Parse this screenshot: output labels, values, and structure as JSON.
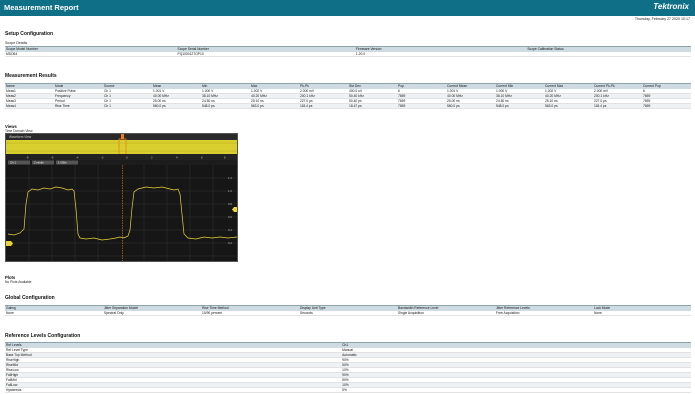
{
  "header": {
    "title": "Measurement Report",
    "logo": "Tektronix",
    "date": "Thursday, February 27 2020 10:17"
  },
  "setup": {
    "title": "Setup Configuration",
    "subtitle": "Scope Details",
    "columns": [
      "Scope Model Number",
      "Scope Serial Number",
      "Firmware Version",
      "Scope Calibration Status"
    ],
    "row": [
      "MSO64",
      "PQ100012TOP10",
      "1.20.0",
      ""
    ]
  },
  "results": {
    "title": "Measurement Results",
    "columns": [
      "Name",
      "Mode",
      "Source",
      "Mean",
      "Min",
      "Max",
      "Pk-Pk",
      "Std Dev",
      "Pop",
      "Current Mean",
      "Current Min",
      "Current Max",
      "Current Pk-Pk",
      "Current Pop"
    ],
    "rows": [
      [
        "Meas1",
        "Positive Pulse",
        "Ch 1",
        "1.001 V",
        "1.000 V",
        "1.002 V",
        "2.000 mV",
        "400.0 uV",
        "6",
        "1.001 V",
        "1.000 V",
        "1.002 V",
        "2.000 mV",
        "6"
      ],
      [
        "Meas2",
        "Frequency",
        "Ch 1",
        "40.00 MHz",
        "38.10 MHz",
        "40.20 MHz",
        "200.1 kHz",
        "50.40 kHz",
        "7659",
        "40.00 MHz",
        "38.10 MHz",
        "40.20 MHz",
        "200.1 kHz",
        "7659"
      ],
      [
        "Meas3",
        "Period",
        "Ch 1",
        "25.00 ns",
        "24.50 ns",
        "25.10 ns",
        "227.0 ps",
        "50.40 ps",
        "7659",
        "25.00 ns",
        "24.50 ns",
        "25.10 ns",
        "227.0 ps",
        "7659"
      ],
      [
        "Meas4",
        "Rise Time",
        "Ch 1",
        "560.0 ps",
        "548.0 ps",
        "563.0 ps",
        "118.4 ps",
        "18.47 ps",
        "7659",
        "560.0 ps",
        "548.0 ps",
        "563.0 ps",
        "118.4 ps",
        "7659"
      ]
    ]
  },
  "views": {
    "title": "Views",
    "subtitle": "Time Domain View",
    "badges": [
      "Waveform View",
      "Ch 1",
      "2 ns/div",
      "1 GS/s"
    ]
  },
  "plots": {
    "title": "Plots",
    "note": "No Plots Available"
  },
  "global": {
    "title": "Global Configuration",
    "columns": [
      "Gating",
      "Jitter Separation Model",
      "Rise Time Method",
      "Display Unit Type",
      "Bandwidth Reference Level",
      "Jitter Reference Levels",
      "Lock Mode"
    ],
    "row": [
      "None",
      "Spectral Only",
      "10/90 percent",
      "Seconds",
      "Single Acquisition",
      "Free Acquisition",
      "None"
    ]
  },
  "reference": {
    "title": "Reference Levels Configuration",
    "columns": [
      "Ref Levels",
      "Ch1"
    ],
    "rows": [
      [
        "Ref Level Type",
        "Manual"
      ],
      [
        "Base Top Method",
        "Automatic"
      ],
      [
        "RiseHigh",
        "90%"
      ],
      [
        "RiseMid",
        "50%"
      ],
      [
        "RiseLow",
        "10%"
      ],
      [
        "FallHigh",
        "90%"
      ],
      [
        "FallMid",
        "50%"
      ],
      [
        "FallLow",
        "10%"
      ],
      [
        "Hysteresis",
        "5%"
      ]
    ]
  },
  "colors": {
    "banner": "#0f6f86",
    "table_header": "#cfdbe2",
    "trace": "#e8d43a",
    "scope_bg": "#161616"
  }
}
